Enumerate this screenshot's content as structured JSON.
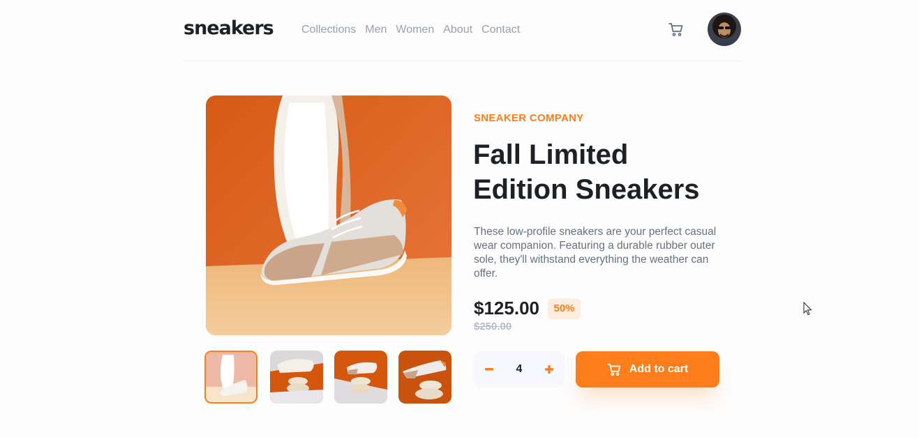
{
  "header": {
    "logo": "sneakers",
    "nav": [
      "Collections",
      "Men",
      "Women",
      "About",
      "Contact"
    ],
    "cart_icon": "cart-icon",
    "avatar_icon": "user-avatar"
  },
  "gallery": {
    "main_image": "sneaker-product-photo",
    "thumbnails": [
      "thumbnail-1",
      "thumbnail-2",
      "thumbnail-3",
      "thumbnail-4"
    ],
    "active_thumbnail": 1
  },
  "product": {
    "company": "SNEAKER COMPANY",
    "title": "Fall Limited Edition Sneakers",
    "description": "These low-profile sneakers are your perfect casual wear companion. Featuring a durable rubber outer sole, they'll withstand everything the weather can offer.",
    "price": "$125.00",
    "discount": "50%",
    "original_price": "$250.00"
  },
  "quantity": {
    "value": "4",
    "minus_icon": "minus-icon",
    "plus_icon": "plus-icon"
  },
  "add_to_cart": {
    "label": "Add to cart",
    "icon": "cart-icon"
  },
  "colors": {
    "accent": "#ff7d1a",
    "accent_pale": "#ffede0",
    "dark": "#1d2025",
    "grey": "#68707d",
    "light_grey": "#b6bcc8",
    "qty_bg": "#f6f8fd"
  }
}
